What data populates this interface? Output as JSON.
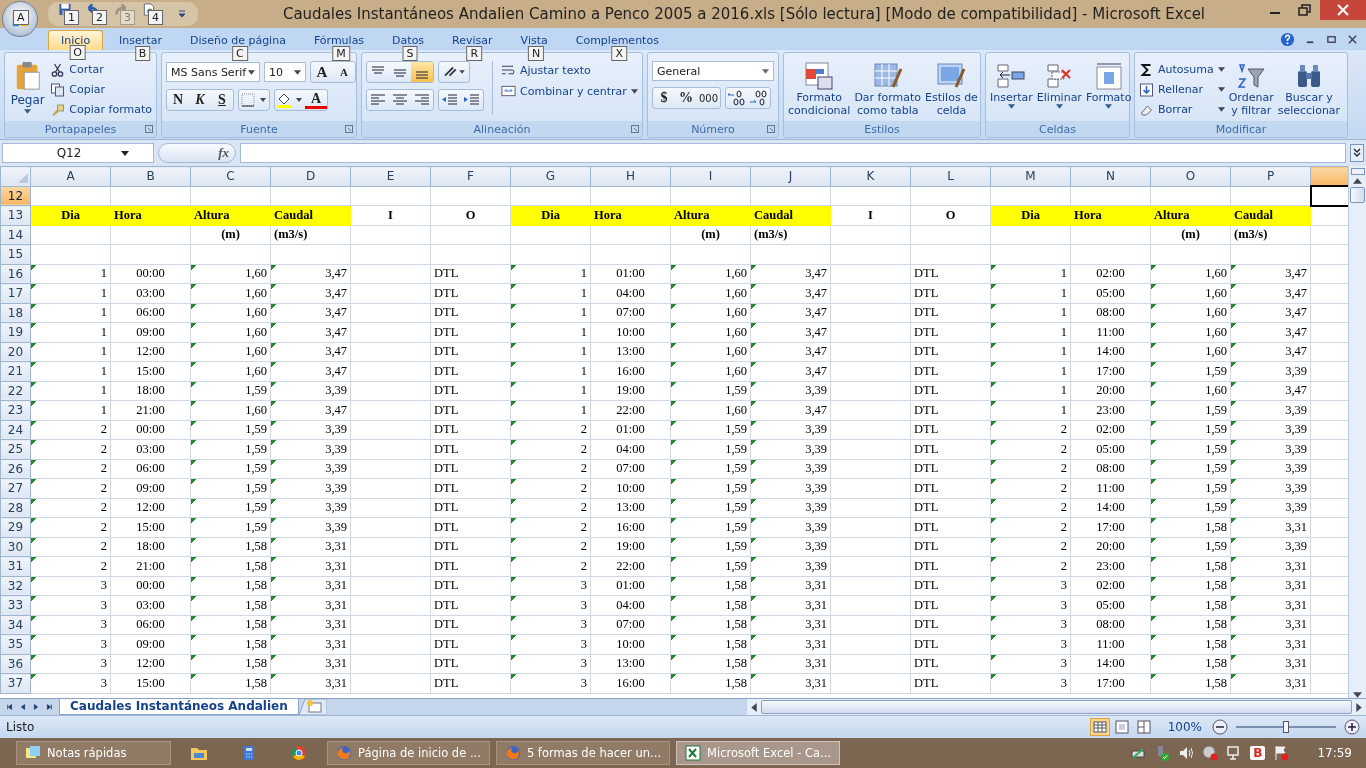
{
  "window": {
    "title": "Caudales Instantáneos Andalien Camino a Penco 2005 a 2016.xls  [Sólo lectura]  [Modo de compatibilidad] - Microsoft Excel"
  },
  "office_button": {
    "keytip": "A"
  },
  "quick_access": [
    {
      "kind": "save",
      "keytip": "1",
      "disabled": false
    },
    {
      "kind": "undo",
      "keytip": "2",
      "disabled": false
    },
    {
      "kind": "redo",
      "keytip": "3",
      "disabled": true
    },
    {
      "kind": "preview",
      "keytip": "4",
      "disabled": false
    }
  ],
  "tabs": [
    {
      "label": "Inicio",
      "keytip": "O",
      "selected": true
    },
    {
      "label": "Insertar",
      "keytip": "B",
      "selected": false
    },
    {
      "label": "Diseño de página",
      "keytip": "C",
      "selected": false
    },
    {
      "label": "Fórmulas",
      "keytip": "M",
      "selected": false
    },
    {
      "label": "Datos",
      "keytip": "S",
      "selected": false
    },
    {
      "label": "Revisar",
      "keytip": "R",
      "selected": false
    },
    {
      "label": "Vista",
      "keytip": "N",
      "selected": false
    },
    {
      "label": "Complementos",
      "keytip": "X",
      "selected": false
    }
  ],
  "ribbon": {
    "portapapeles": {
      "title": "Portapapeles",
      "paste": "Pegar",
      "cut": "Cortar",
      "copy": "Copiar",
      "format_painter": "Copiar formato"
    },
    "fuente": {
      "title": "Fuente",
      "font": "MS Sans Serif",
      "size": "10",
      "grow": "A",
      "shrink": "A",
      "bold": "N",
      "italic": "K",
      "underline": "S",
      "font_color": "A"
    },
    "alineacion": {
      "title": "Alineación",
      "vertical": [
        {
          "selected": false
        },
        {
          "selected": false
        },
        {
          "selected": true
        }
      ],
      "horizontal": [
        {
          "selected": false
        },
        {
          "selected": false
        },
        {
          "selected": false
        }
      ],
      "wrap": "Ajustar texto",
      "merge": "Combinar y centrar"
    },
    "numero": {
      "title": "Número",
      "format": "General",
      "currency": "$",
      "percent": "%",
      "thousands": "000"
    },
    "estilos": {
      "title": "Estilos",
      "items": [
        {
          "kind": "conditional",
          "lines": [
            "Formato",
            "condicional"
          ]
        },
        {
          "kind": "table",
          "lines": [
            "Dar formato",
            "como tabla"
          ]
        },
        {
          "kind": "cellstyle",
          "lines": [
            "Estilos de",
            "celda"
          ]
        }
      ]
    },
    "celdas": {
      "title": "Celdas",
      "items": [
        {
          "kind": "insert",
          "label": "Insertar"
        },
        {
          "kind": "delete",
          "label": "Eliminar"
        },
        {
          "kind": "format",
          "label": "Formato"
        }
      ]
    },
    "modificar": {
      "title": "Modificar",
      "autosum": "Autosuma",
      "fill": "Rellenar",
      "clear": "Borrar",
      "sort": [
        "Ordenar",
        "y filtrar"
      ],
      "find": [
        "Buscar y",
        "seleccionar"
      ]
    }
  },
  "formula_bar": {
    "name_box": "Q12",
    "fx": "fx"
  },
  "columns": [
    {
      "label": "A",
      "selected": false
    },
    {
      "label": "B",
      "selected": false
    },
    {
      "label": "C",
      "selected": false
    },
    {
      "label": "D",
      "selected": false
    },
    {
      "label": "E",
      "selected": false
    },
    {
      "label": "F",
      "selected": false
    },
    {
      "label": "G",
      "selected": false
    },
    {
      "label": "H",
      "selected": false
    },
    {
      "label": "I",
      "selected": false
    },
    {
      "label": "J",
      "selected": false
    },
    {
      "label": "K",
      "selected": false
    },
    {
      "label": "L",
      "selected": false
    },
    {
      "label": "M",
      "selected": false
    },
    {
      "label": "N",
      "selected": false
    },
    {
      "label": "O",
      "selected": false
    },
    {
      "label": "P",
      "selected": false
    }
  ],
  "partial_column": {
    "selected": true
  },
  "rows": [
    {
      "n": "12",
      "kind": "blank",
      "selected": true
    },
    {
      "n": "13",
      "kind": "title",
      "selected": false,
      "g": [
        [
          "Dia",
          "Hora",
          "Altura",
          "Caudal",
          "I",
          "O"
        ],
        [
          "Dia",
          "Hora",
          "Altura",
          "Caudal",
          "I",
          "O"
        ],
        [
          "Dia",
          "Hora",
          "Altura",
          "Caudal"
        ]
      ]
    },
    {
      "n": "14",
      "kind": "units",
      "selected": false,
      "g": [
        [
          "(m)",
          "(m3/s)"
        ],
        [
          "(m)",
          "(m3/s)"
        ],
        [
          "(m)",
          "(m3/s)"
        ]
      ]
    },
    {
      "n": "15",
      "kind": "blank",
      "selected": false
    },
    {
      "n": "16",
      "kind": "data",
      "selected": false,
      "g": [
        [
          "1",
          "00:00",
          "1,60",
          "3,47",
          "DTL"
        ],
        [
          "1",
          "01:00",
          "1,60",
          "3,47",
          "DTL"
        ],
        [
          "1",
          "02:00",
          "1,60",
          "3,47"
        ]
      ]
    },
    {
      "n": "17",
      "kind": "data",
      "selected": false,
      "g": [
        [
          "1",
          "03:00",
          "1,60",
          "3,47",
          "DTL"
        ],
        [
          "1",
          "04:00",
          "1,60",
          "3,47",
          "DTL"
        ],
        [
          "1",
          "05:00",
          "1,60",
          "3,47"
        ]
      ]
    },
    {
      "n": "18",
      "kind": "data",
      "selected": false,
      "g": [
        [
          "1",
          "06:00",
          "1,60",
          "3,47",
          "DTL"
        ],
        [
          "1",
          "07:00",
          "1,60",
          "3,47",
          "DTL"
        ],
        [
          "1",
          "08:00",
          "1,60",
          "3,47"
        ]
      ]
    },
    {
      "n": "19",
      "kind": "data",
      "selected": false,
      "g": [
        [
          "1",
          "09:00",
          "1,60",
          "3,47",
          "DTL"
        ],
        [
          "1",
          "10:00",
          "1,60",
          "3,47",
          "DTL"
        ],
        [
          "1",
          "11:00",
          "1,60",
          "3,47"
        ]
      ]
    },
    {
      "n": "20",
      "kind": "data",
      "selected": false,
      "g": [
        [
          "1",
          "12:00",
          "1,60",
          "3,47",
          "DTL"
        ],
        [
          "1",
          "13:00",
          "1,60",
          "3,47",
          "DTL"
        ],
        [
          "1",
          "14:00",
          "1,60",
          "3,47"
        ]
      ]
    },
    {
      "n": "21",
      "kind": "data",
      "selected": false,
      "g": [
        [
          "1",
          "15:00",
          "1,60",
          "3,47",
          "DTL"
        ],
        [
          "1",
          "16:00",
          "1,60",
          "3,47",
          "DTL"
        ],
        [
          "1",
          "17:00",
          "1,59",
          "3,39"
        ]
      ]
    },
    {
      "n": "22",
      "kind": "data",
      "selected": false,
      "g": [
        [
          "1",
          "18:00",
          "1,59",
          "3,39",
          "DTL"
        ],
        [
          "1",
          "19:00",
          "1,59",
          "3,39",
          "DTL"
        ],
        [
          "1",
          "20:00",
          "1,60",
          "3,47"
        ]
      ]
    },
    {
      "n": "23",
      "kind": "data",
      "selected": false,
      "g": [
        [
          "1",
          "21:00",
          "1,60",
          "3,47",
          "DTL"
        ],
        [
          "1",
          "22:00",
          "1,60",
          "3,47",
          "DTL"
        ],
        [
          "1",
          "23:00",
          "1,59",
          "3,39"
        ]
      ]
    },
    {
      "n": "24",
      "kind": "data",
      "selected": false,
      "g": [
        [
          "2",
          "00:00",
          "1,59",
          "3,39",
          "DTL"
        ],
        [
          "2",
          "01:00",
          "1,59",
          "3,39",
          "DTL"
        ],
        [
          "2",
          "02:00",
          "1,59",
          "3,39"
        ]
      ]
    },
    {
      "n": "25",
      "kind": "data",
      "selected": false,
      "g": [
        [
          "2",
          "03:00",
          "1,59",
          "3,39",
          "DTL"
        ],
        [
          "2",
          "04:00",
          "1,59",
          "3,39",
          "DTL"
        ],
        [
          "2",
          "05:00",
          "1,59",
          "3,39"
        ]
      ]
    },
    {
      "n": "26",
      "kind": "data",
      "selected": false,
      "g": [
        [
          "2",
          "06:00",
          "1,59",
          "3,39",
          "DTL"
        ],
        [
          "2",
          "07:00",
          "1,59",
          "3,39",
          "DTL"
        ],
        [
          "2",
          "08:00",
          "1,59",
          "3,39"
        ]
      ]
    },
    {
      "n": "27",
      "kind": "data",
      "selected": false,
      "g": [
        [
          "2",
          "09:00",
          "1,59",
          "3,39",
          "DTL"
        ],
        [
          "2",
          "10:00",
          "1,59",
          "3,39",
          "DTL"
        ],
        [
          "2",
          "11:00",
          "1,59",
          "3,39"
        ]
      ]
    },
    {
      "n": "28",
      "kind": "data",
      "selected": false,
      "g": [
        [
          "2",
          "12:00",
          "1,59",
          "3,39",
          "DTL"
        ],
        [
          "2",
          "13:00",
          "1,59",
          "3,39",
          "DTL"
        ],
        [
          "2",
          "14:00",
          "1,59",
          "3,39"
        ]
      ]
    },
    {
      "n": "29",
      "kind": "data",
      "selected": false,
      "g": [
        [
          "2",
          "15:00",
          "1,59",
          "3,39",
          "DTL"
        ],
        [
          "2",
          "16:00",
          "1,59",
          "3,39",
          "DTL"
        ],
        [
          "2",
          "17:00",
          "1,58",
          "3,31"
        ]
      ]
    },
    {
      "n": "30",
      "kind": "data",
      "selected": false,
      "g": [
        [
          "2",
          "18:00",
          "1,58",
          "3,31",
          "DTL"
        ],
        [
          "2",
          "19:00",
          "1,59",
          "3,39",
          "DTL"
        ],
        [
          "2",
          "20:00",
          "1,59",
          "3,39"
        ]
      ]
    },
    {
      "n": "31",
      "kind": "data",
      "selected": false,
      "g": [
        [
          "2",
          "21:00",
          "1,58",
          "3,31",
          "DTL"
        ],
        [
          "2",
          "22:00",
          "1,59",
          "3,39",
          "DTL"
        ],
        [
          "2",
          "23:00",
          "1,58",
          "3,31"
        ]
      ]
    },
    {
      "n": "32",
      "kind": "data",
      "selected": false,
      "g": [
        [
          "3",
          "00:00",
          "1,58",
          "3,31",
          "DTL"
        ],
        [
          "3",
          "01:00",
          "1,58",
          "3,31",
          "DTL"
        ],
        [
          "3",
          "02:00",
          "1,58",
          "3,31"
        ]
      ]
    },
    {
      "n": "33",
      "kind": "data",
      "selected": false,
      "g": [
        [
          "3",
          "03:00",
          "1,58",
          "3,31",
          "DTL"
        ],
        [
          "3",
          "04:00",
          "1,58",
          "3,31",
          "DTL"
        ],
        [
          "3",
          "05:00",
          "1,58",
          "3,31"
        ]
      ]
    },
    {
      "n": "34",
      "kind": "data",
      "selected": false,
      "g": [
        [
          "3",
          "06:00",
          "1,58",
          "3,31",
          "DTL"
        ],
        [
          "3",
          "07:00",
          "1,58",
          "3,31",
          "DTL"
        ],
        [
          "3",
          "08:00",
          "1,58",
          "3,31"
        ]
      ]
    },
    {
      "n": "35",
      "kind": "data",
      "selected": false,
      "g": [
        [
          "3",
          "09:00",
          "1,58",
          "3,31",
          "DTL"
        ],
        [
          "3",
          "10:00",
          "1,58",
          "3,31",
          "DTL"
        ],
        [
          "3",
          "11:00",
          "1,58",
          "3,31"
        ]
      ]
    },
    {
      "n": "36",
      "kind": "data",
      "selected": false,
      "g": [
        [
          "3",
          "12:00",
          "1,58",
          "3,31",
          "DTL"
        ],
        [
          "3",
          "13:00",
          "1,58",
          "3,31",
          "DTL"
        ],
        [
          "3",
          "14:00",
          "1,58",
          "3,31"
        ]
      ]
    },
    {
      "n": "37",
      "kind": "data",
      "selected": false,
      "g": [
        [
          "3",
          "15:00",
          "1,58",
          "3,31",
          "DTL"
        ],
        [
          "3",
          "16:00",
          "1,58",
          "3,31",
          "DTL"
        ],
        [
          "3",
          "17:00",
          "1,58",
          "3,31"
        ]
      ]
    }
  ],
  "sheet_tabs": [
    {
      "label": "Caudales Instantáneos Andalien",
      "selected": true
    }
  ],
  "status_bar": {
    "status": "Listo",
    "zoom": "100%",
    "zoom_slider": {
      "level": 0.5
    },
    "views": [
      {
        "kind": "normal",
        "selected": true
      },
      {
        "kind": "layout",
        "selected": false
      },
      {
        "kind": "pagebreak",
        "selected": false
      }
    ]
  },
  "taskbar": {
    "items": [
      {
        "kind": "notes",
        "label": "Notas rápidas",
        "active": false
      },
      {
        "kind": "folder",
        "active": false
      },
      {
        "kind": "calculator",
        "active": false
      },
      {
        "kind": "chrome",
        "active": false
      },
      {
        "kind": "firefox",
        "label": "Página de inicio de ...",
        "active": false
      },
      {
        "kind": "firefox",
        "label": "5 formas de hacer un...",
        "active": false
      },
      {
        "kind": "excel",
        "label": "Microsoft Excel - Ca...",
        "active": true
      }
    ],
    "tray_badge": "B",
    "clock": "17:59"
  }
}
